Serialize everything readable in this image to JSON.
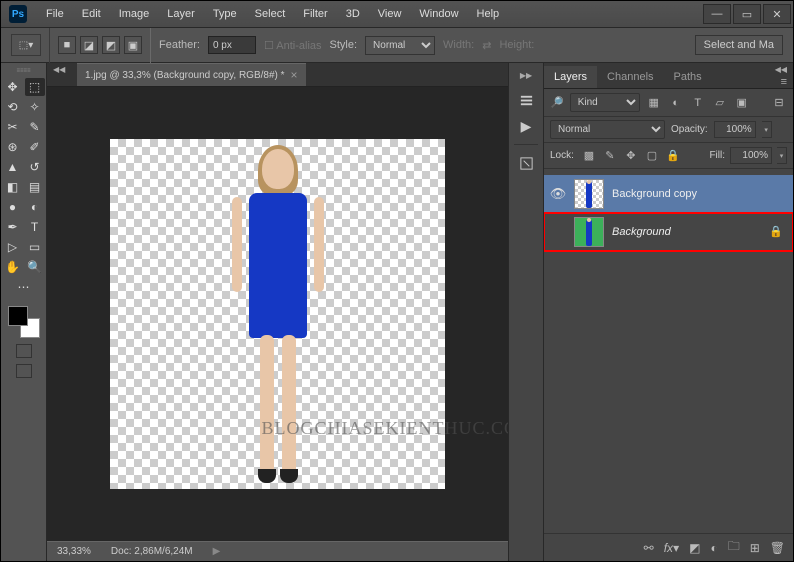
{
  "menu": {
    "items": [
      "File",
      "Edit",
      "Image",
      "Layer",
      "Type",
      "Select",
      "Filter",
      "3D",
      "View",
      "Window",
      "Help"
    ]
  },
  "options": {
    "feather_label": "Feather:",
    "feather_value": "0 px",
    "antialias_label": "Anti-alias",
    "style_label": "Style:",
    "style_value": "Normal",
    "width_label": "Width:",
    "height_label": "Height:",
    "select_mask_label": "Select and Ma"
  },
  "doc": {
    "tab_title": "1.jpg @ 33,3% (Background copy, RGB/8#) *"
  },
  "status": {
    "zoom": "33,33%",
    "doc_label": "Doc:",
    "doc_size": "2,86M/6,24M"
  },
  "panels": {
    "tabs": [
      "Layers",
      "Channels",
      "Paths"
    ]
  },
  "layers": {
    "filter_kind_icon": "🔎",
    "filter_kind_value": "Kind",
    "blend_mode": "Normal",
    "opacity_label": "Opacity:",
    "opacity_value": "100%",
    "lock_label": "Lock:",
    "fill_label": "Fill:",
    "fill_value": "100%",
    "rows": [
      {
        "name": "Background copy",
        "visible": true,
        "locked": false,
        "selected": true,
        "italic": false,
        "bg": "checker"
      },
      {
        "name": "Background",
        "visible": false,
        "locked": true,
        "selected": false,
        "italic": true,
        "bg": "green",
        "highlighted": true
      }
    ]
  },
  "watermark": "BLOGCHIASEKIENTHUC.COM"
}
